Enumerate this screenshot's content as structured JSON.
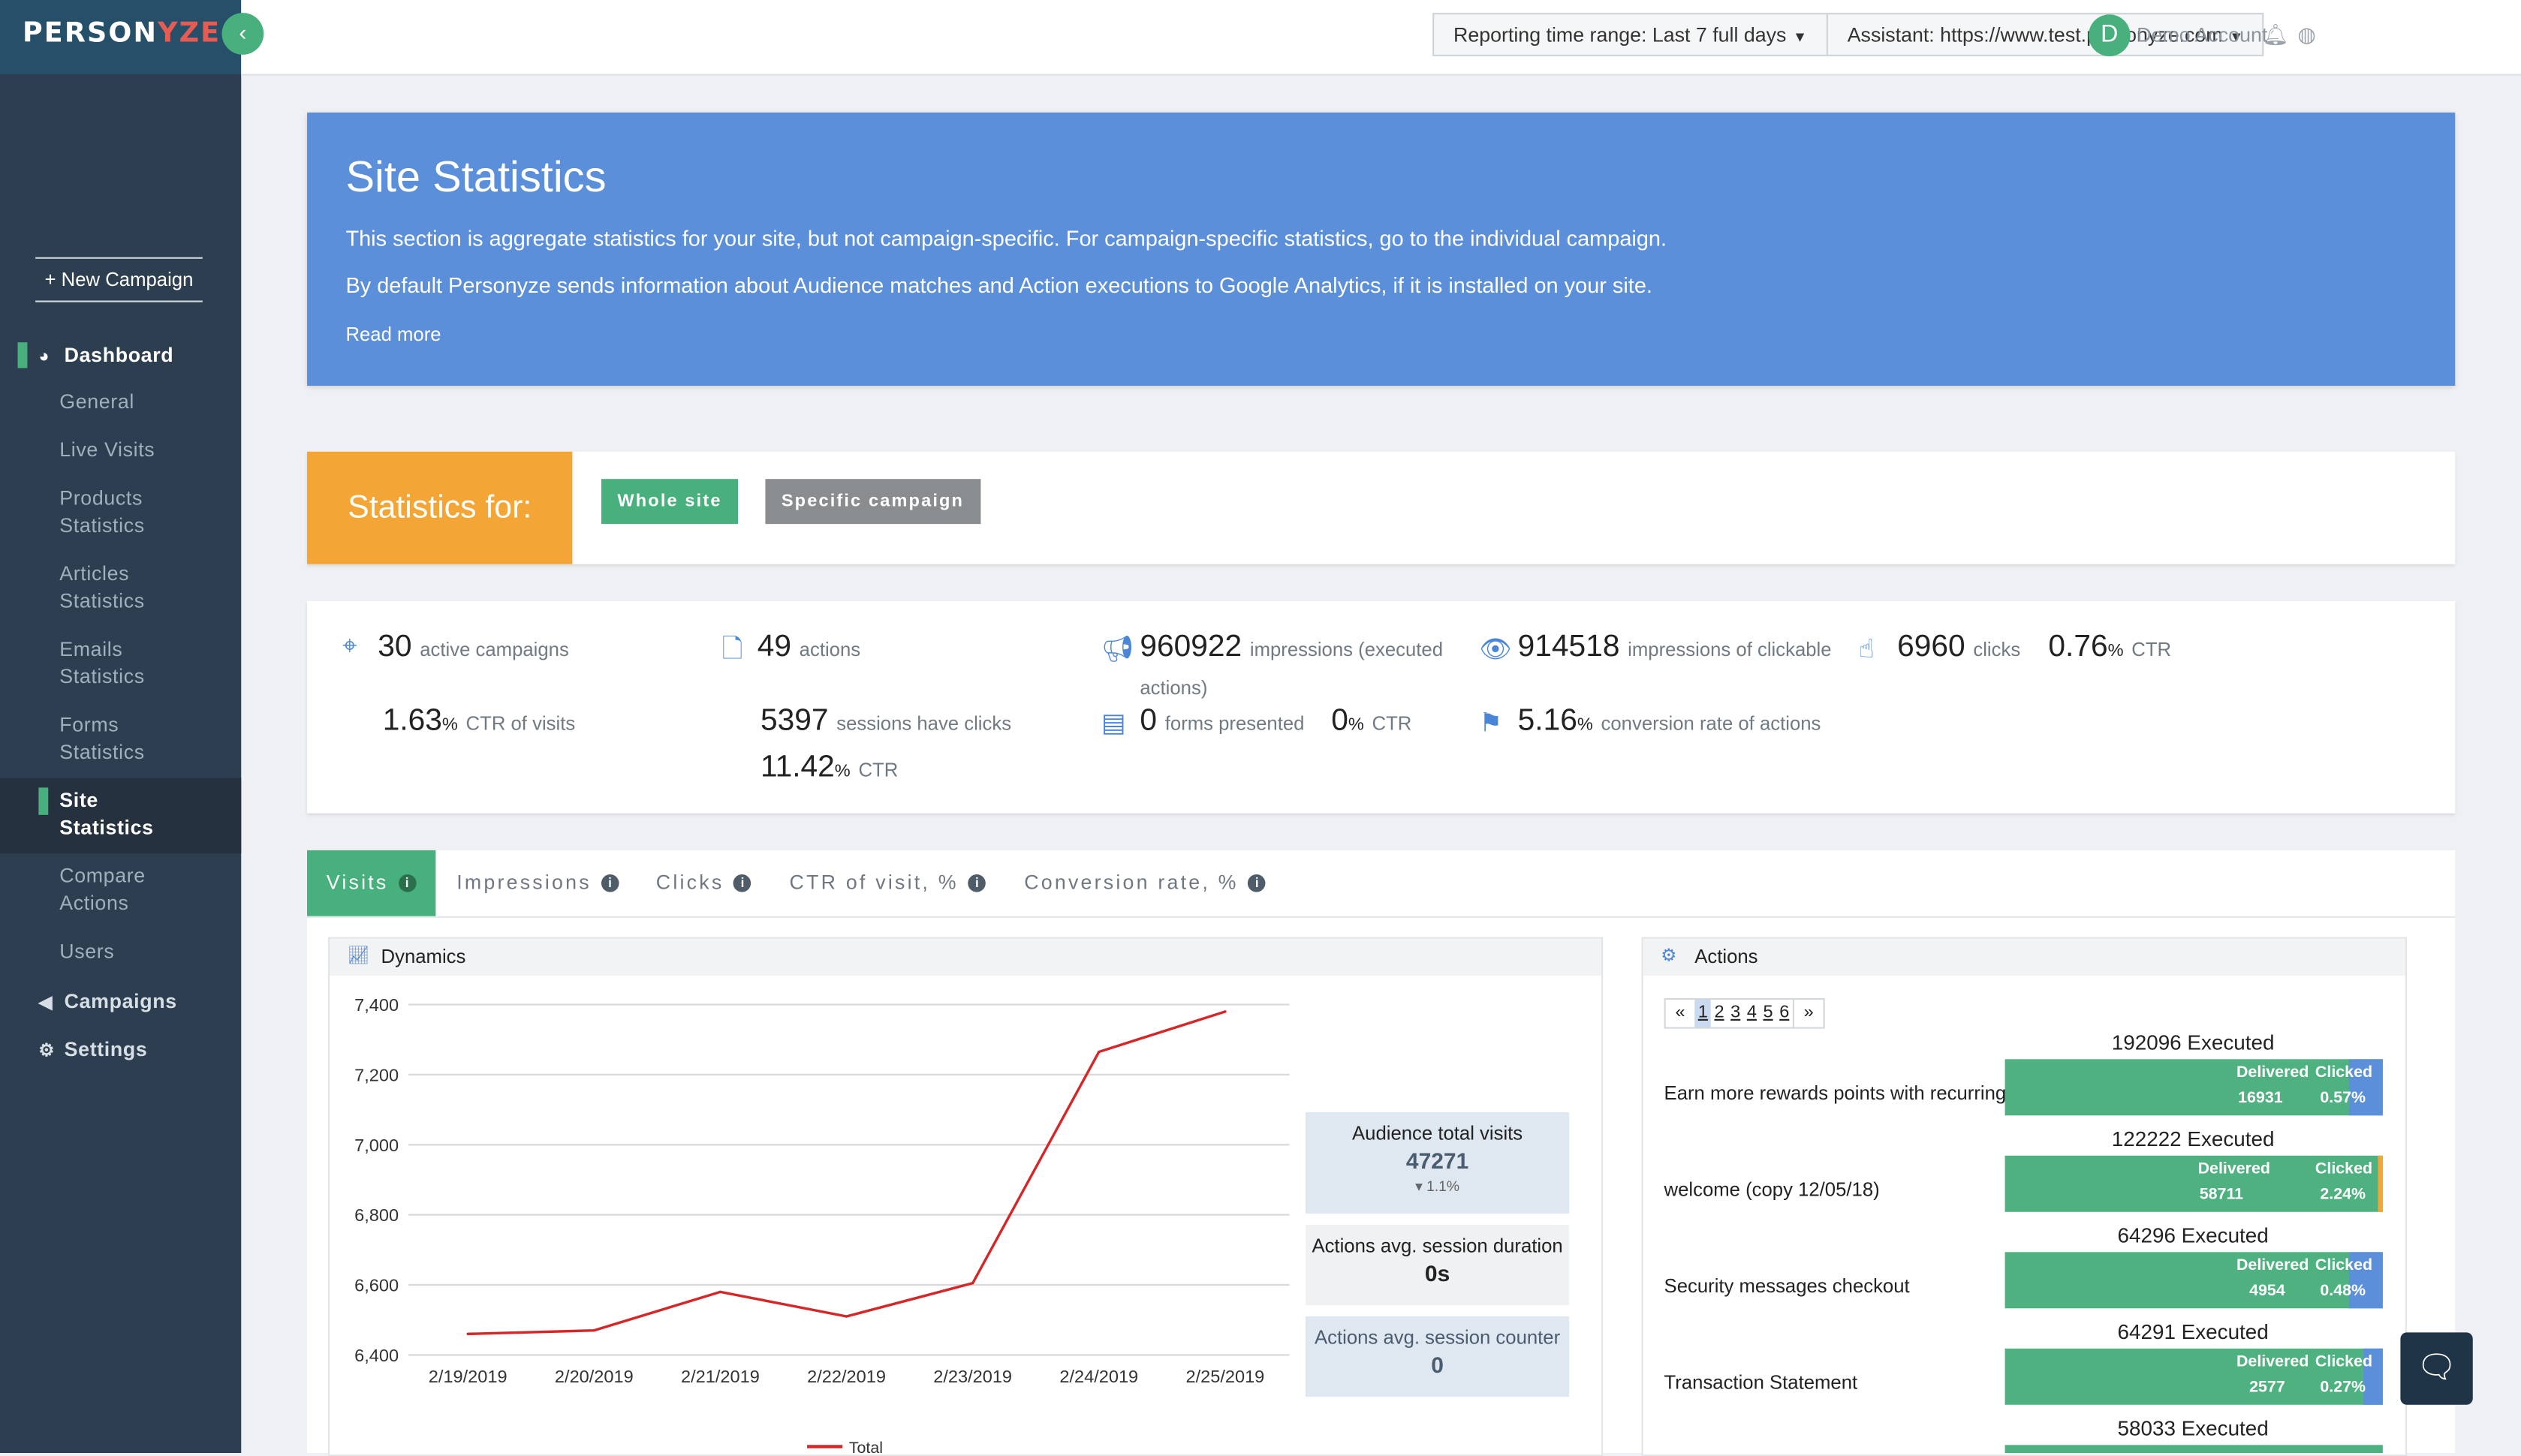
{
  "app": {
    "logo_prefix": "PERSON",
    "logo_accent": "YZE",
    "collapse_icon": "‹"
  },
  "sidebar": {
    "new_campaign": "+ New Campaign",
    "dashboard": "Dashboard",
    "items": [
      {
        "label": "General"
      },
      {
        "label": "Live Visits"
      },
      {
        "label": "Products Statistics"
      },
      {
        "label": "Articles Statistics"
      },
      {
        "label": "Emails Statistics"
      },
      {
        "label": "Forms Statistics"
      },
      {
        "label": "Site Statistics",
        "active": true
      },
      {
        "label": "Compare Actions"
      },
      {
        "label": "Users"
      }
    ],
    "campaigns": "Campaigns",
    "settings": "Settings"
  },
  "topbar": {
    "time_range": "Reporting time range: Last 7 full days",
    "assistant": "Assistant: https://www.test.personyze.com",
    "avatar_letter": "D",
    "account": "Demo Account"
  },
  "banner": {
    "title": "Site Statistics",
    "line1": "This section is aggregate statistics for your site, but not campaign-specific. For campaign-specific statistics, go to the individual campaign.",
    "line2": "By default Personyze sends information about Audience matches and Action executions to Google Analytics, if it is installed on your site.",
    "read_more": "Read more"
  },
  "statsfor": {
    "title": "Statistics for:",
    "whole_site": "Whole site",
    "specific_campaign": "Specific campaign"
  },
  "kpi": {
    "active_campaigns": {
      "value": "30",
      "label": "active campaigns"
    },
    "ctr_visits": {
      "value": "1.63",
      "unit": "%",
      "label": "CTR of visits"
    },
    "actions": {
      "value": "49",
      "label": "actions"
    },
    "sessions_clicks": {
      "value": "5397",
      "label": "sessions have clicks"
    },
    "sessions_ctr": {
      "value": "11.42",
      "unit": "%",
      "label": "CTR"
    },
    "impressions": {
      "value": "960922",
      "label": "impressions (executed",
      "label2": "actions)"
    },
    "forms": {
      "value": "0",
      "label": "forms presented"
    },
    "forms_ctr": {
      "value": "0",
      "unit": "%",
      "label": "CTR"
    },
    "impr_clickable": {
      "value": "914518",
      "label": "impressions of clickable"
    },
    "conversion": {
      "value": "5.16",
      "unit": "%",
      "label": "conversion rate of actions"
    },
    "clicks": {
      "value": "6960",
      "label": "clicks"
    },
    "ctr": {
      "value": "0.76",
      "unit": "%",
      "label": "CTR"
    }
  },
  "tabs": [
    {
      "label": "Visits",
      "active": true
    },
    {
      "label": "Impressions"
    },
    {
      "label": "Clicks"
    },
    {
      "label": "CTR of visit, %"
    },
    {
      "label": "Conversion rate, %"
    }
  ],
  "dynamics": {
    "title": "Dynamics",
    "audience_visits_label": "Audience total visits",
    "audience_visits_value": "47271",
    "audience_visits_change": "▾ 1.1%",
    "session_duration_label": "Actions avg. session duration",
    "session_duration_value": "0s",
    "session_counter_label": "Actions avg. session counter",
    "session_counter_value": "0"
  },
  "chart_data": {
    "type": "line",
    "x": [
      "2/19/2019",
      "2/20/2019",
      "2/21/2019",
      "2/22/2019",
      "2/23/2019",
      "2/24/2019",
      "2/25/2019"
    ],
    "series": [
      {
        "name": "Total",
        "values": [
          6460,
          6470,
          6580,
          6510,
          6605,
          7265,
          7380
        ],
        "color": "#d62728"
      }
    ],
    "ylim": [
      6400,
      7400
    ],
    "yticks": [
      "6,400",
      "6,600",
      "6,800",
      "7,000",
      "7,200",
      "7,400"
    ],
    "legend": "bottom",
    "grid": true
  },
  "actions": {
    "title": "Actions",
    "pager": {
      "prev": "«",
      "pages": [
        "1",
        "2",
        "3",
        "4",
        "5",
        "6"
      ],
      "next": "»"
    },
    "delivered_label": "Delivered",
    "clicked_label": "Clicked",
    "rows": [
      {
        "count": "192096 Executed",
        "name": "Earn more rewards points with recurring",
        "delivered": "16931",
        "clicked": "0.57%",
        "clicked_frac": 0.09
      },
      {
        "count": "122222 Executed",
        "name": "welcome (copy 12/05/18)",
        "delivered": "58711",
        "clicked": "2.24%",
        "clicked_frac": 0.0
      },
      {
        "count": "64296 Executed",
        "name": "Security messages checkout",
        "delivered": "4954",
        "clicked": "0.48%",
        "clicked_frac": 0.09
      },
      {
        "count": "64291 Executed",
        "name": "Transaction Statement",
        "delivered": "2577",
        "clicked": "0.27%",
        "clicked_frac": 0.05
      },
      {
        "count": "58033 Executed"
      }
    ]
  }
}
